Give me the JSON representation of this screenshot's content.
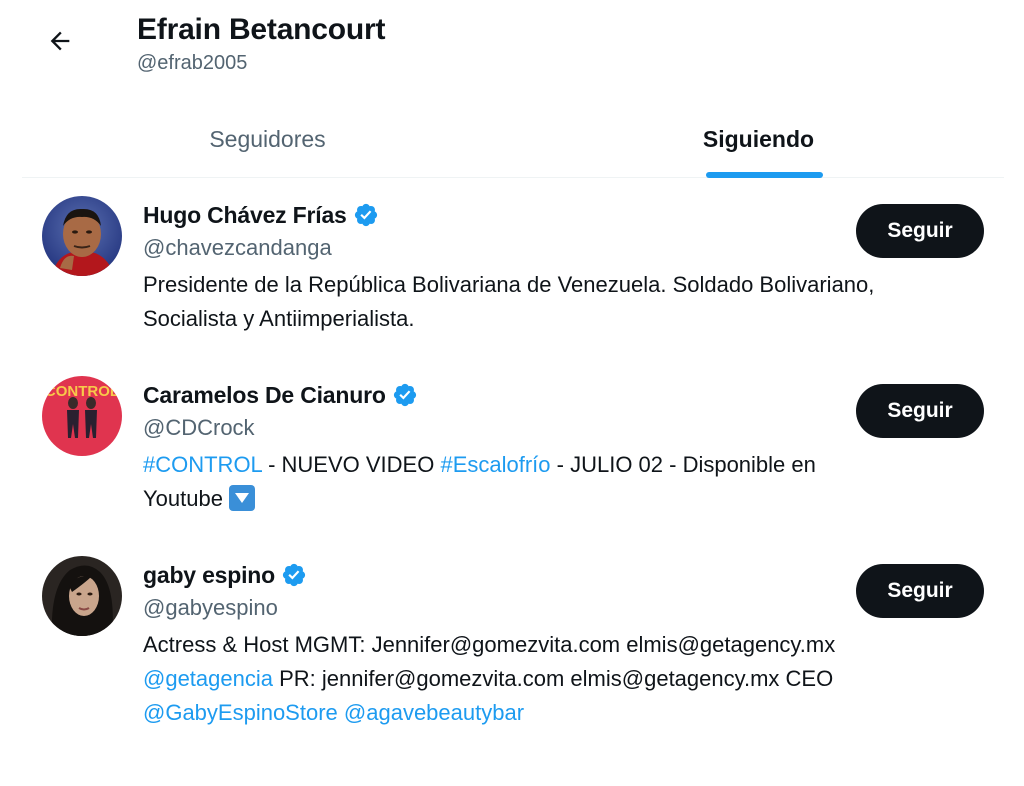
{
  "header": {
    "name": "Efrain Betancourt",
    "handle": "@efrab2005",
    "back_icon": "arrow-left-icon"
  },
  "tabs": [
    {
      "label": "Seguidores",
      "active": false
    },
    {
      "label": "Siguiendo",
      "active": true
    }
  ],
  "colors": {
    "accent": "#1d9bf0",
    "text_primary": "#0f1419",
    "text_secondary": "#536471",
    "button_bg": "#0f1419"
  },
  "users": [
    {
      "name": "Hugo Chávez Frías",
      "handle": "@chavezcandanga",
      "verified": true,
      "button": "Seguir",
      "bio_line1": "Presidente de la República Bolivariana de Venezuela. Soldado Bolivariano,",
      "bio_line2": "Socialista y Antiimperialista."
    },
    {
      "name": "Caramelos De Cianuro",
      "handle": "@CDCrock",
      "verified": true,
      "button": "Seguir",
      "bio_hashtag1": "#CONTROL",
      "bio_text1": " - NUEVO VIDEO ",
      "bio_hashtag2": "#Escalofrío",
      "bio_text2": " - JULIO 02 - Disponible en",
      "bio_text3": "Youtube ",
      "bio_icon": "down-arrow-emoji-icon"
    },
    {
      "name": "gaby espino",
      "handle": "@gabyespino",
      "verified": true,
      "button": "Seguir",
      "bio_line1": "Actress & Host MGMT: Jennifer@gomezvita.com elmis@getagency.mx",
      "bio_mention1": "@getagencia",
      "bio_text2": " PR: jennifer@gomezvita.com elmis@getagency.mx CEO",
      "bio_mention2": "@GabyEspinoStore",
      "bio_mention3": "@agavebeautybar"
    }
  ]
}
